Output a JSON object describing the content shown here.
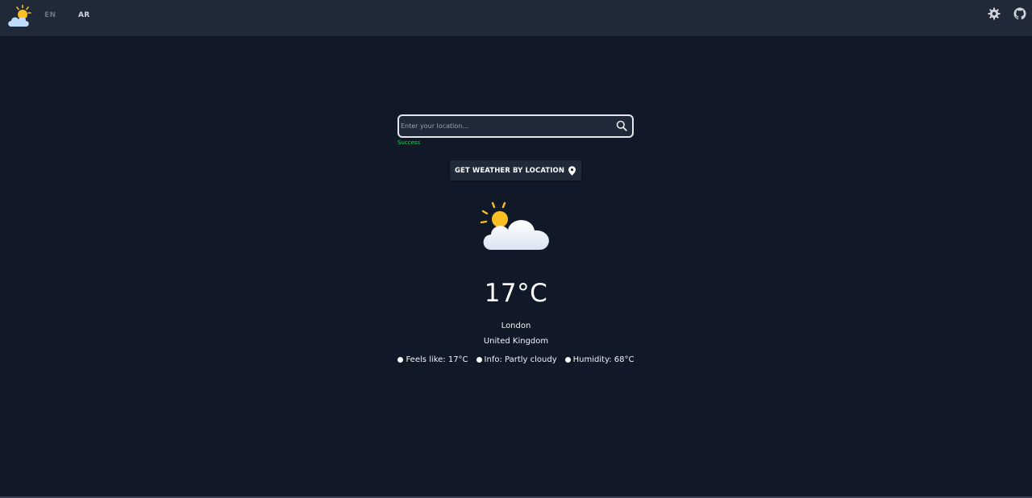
{
  "header": {
    "languages": [
      {
        "label": "EN",
        "active": false
      },
      {
        "label": "AR",
        "active": true
      }
    ]
  },
  "search": {
    "value": "",
    "placeholder": "Enter your location...",
    "status": "Success"
  },
  "location_button": {
    "label": "GET WEATHER BY LOCATION"
  },
  "weather": {
    "icon": "partly-cloudy-icon",
    "temperature": "17°C",
    "city": "London",
    "country": "United Kingdom",
    "details": [
      {
        "text": "Feels like: 17°C"
      },
      {
        "text": "Info: Partly cloudy"
      },
      {
        "text": "Humidity: 68°C"
      }
    ]
  },
  "colors": {
    "background": "#111827",
    "header": "#1f2937",
    "success": "#22c55e",
    "sun": "#fbbf24"
  }
}
